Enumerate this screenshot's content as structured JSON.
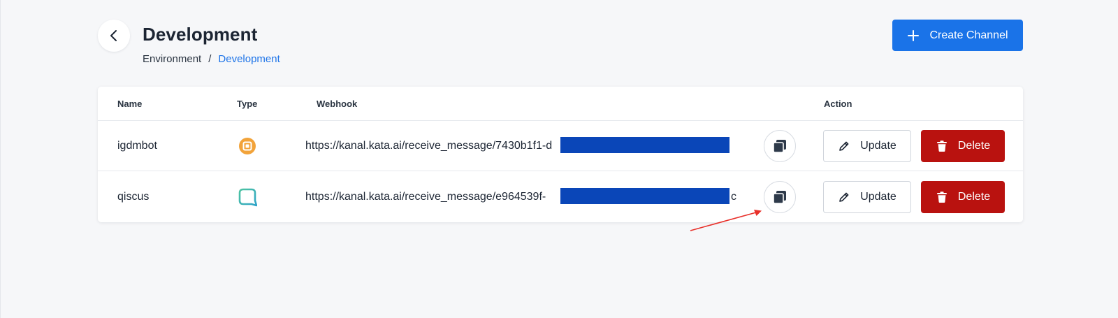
{
  "header": {
    "title": "Development",
    "back_icon": "chevron-left-icon",
    "breadcrumb": {
      "root": "Environment",
      "separator": "/",
      "current": "Development"
    },
    "create_button": {
      "label": "Create Channel",
      "icon": "plus-icon"
    }
  },
  "table": {
    "columns": {
      "name": "Name",
      "type": "Type",
      "webhook": "Webhook",
      "action": "Action"
    },
    "rows": [
      {
        "name": "igdmbot",
        "type_icon": "instagram-dm-icon",
        "webhook": "https://kanal.kata.ai/receive_message/7430b1f1-d",
        "copy_icon": "copy-icon",
        "update_label": "Update",
        "delete_label": "Delete"
      },
      {
        "name": "qiscus",
        "type_icon": "qiscus-icon",
        "webhook": "https://kanal.kata.ai/receive_message/e964539f-",
        "webhook_tail": "c",
        "copy_icon": "copy-icon",
        "update_label": "Update",
        "delete_label": "Delete"
      }
    ]
  },
  "colors": {
    "primary": "#1a73e8",
    "danger": "#b9120f",
    "redaction": "#0a46b8",
    "annotation_arrow": "#e8302a"
  }
}
